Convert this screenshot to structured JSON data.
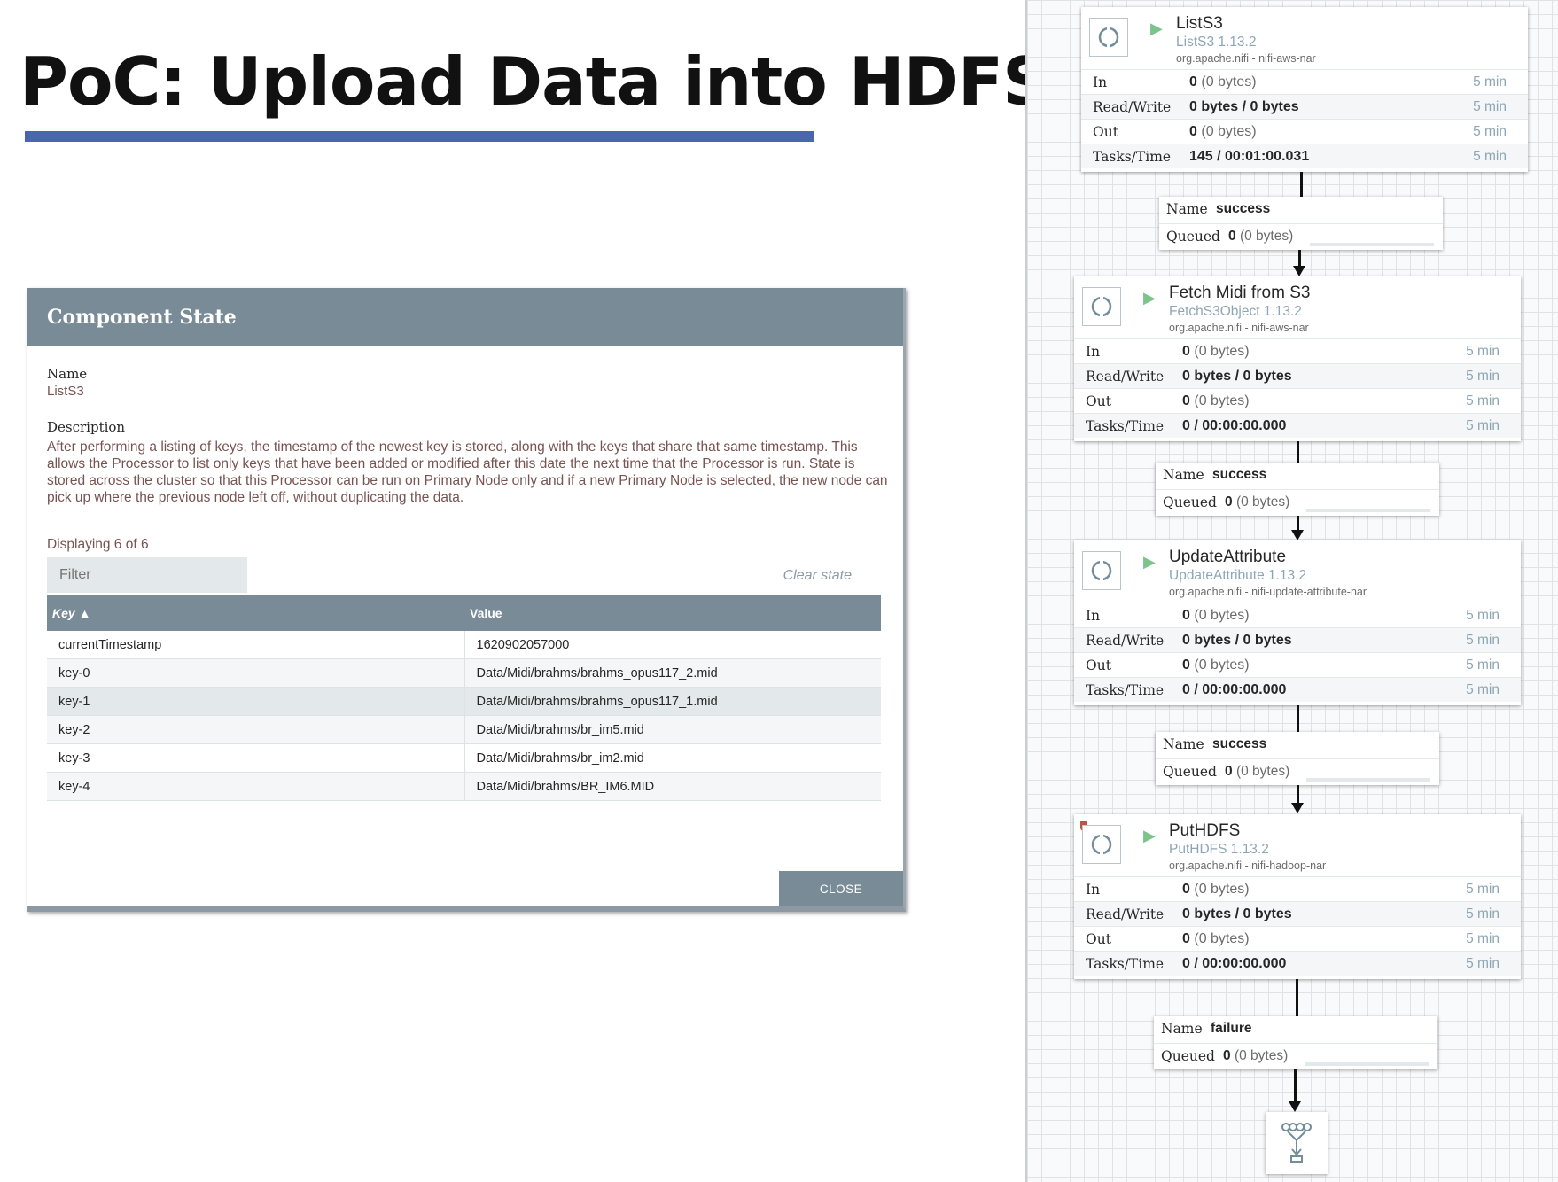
{
  "slide": {
    "title": "PoC: Upload Data into HDFS"
  },
  "dialog": {
    "title": "Component State",
    "name_label": "Name",
    "name_value": "ListS3",
    "description_label": "Description",
    "description": "After performing a listing of keys, the timestamp of the newest key is stored, along with the keys that share that same timestamp. This allows the Processor to list only keys that have been added or modified after this date the next time that the Processor is run. State is stored across the cluster so that this Processor can be run on Primary Node only and if a new Primary Node is selected, the new node can pick up where the previous node left off, without duplicating the data.",
    "displaying": "Displaying 6 of 6",
    "filter_placeholder": "Filter",
    "clear_state": "Clear state",
    "columns": {
      "key": "Key ▲",
      "value": "Value"
    },
    "rows": [
      {
        "key": "currentTimestamp",
        "value": "1620902057000"
      },
      {
        "key": "key-0",
        "value": "Data/Midi/brahms/brahms_opus117_2.mid"
      },
      {
        "key": "key-1",
        "value": "Data/Midi/brahms/brahms_opus117_1.mid"
      },
      {
        "key": "key-2",
        "value": "Data/Midi/brahms/br_im5.mid"
      },
      {
        "key": "key-3",
        "value": "Data/Midi/brahms/br_im2.mid"
      },
      {
        "key": "key-4",
        "value": "Data/Midi/brahms/BR_IM6.MID"
      }
    ],
    "close_label": "CLOSE"
  },
  "stat_labels": {
    "in": "In",
    "rw": "Read/Write",
    "out": "Out",
    "tasks": "Tasks/Time",
    "time": "5 min"
  },
  "conn_labels": {
    "name": "Name",
    "queued": "Queued",
    "count": "0",
    "bytes": "(0 bytes)"
  },
  "processors": [
    {
      "name": "ListS3",
      "type": "ListS3 1.13.2",
      "bundle": "org.apache.nifi - nifi-aws-nar",
      "in_count": "0",
      "in_bytes": "(0 bytes)",
      "rw": "0 bytes / 0 bytes",
      "out_count": "0",
      "out_bytes": "(0 bytes)",
      "tasks": "145 / 00:01:00.031"
    },
    {
      "name": "Fetch Midi from S3",
      "type": "FetchS3Object 1.13.2",
      "bundle": "org.apache.nifi - nifi-aws-nar",
      "in_count": "0",
      "in_bytes": "(0 bytes)",
      "rw": "0 bytes / 0 bytes",
      "out_count": "0",
      "out_bytes": "(0 bytes)",
      "tasks": "0 / 00:00:00.000"
    },
    {
      "name": "UpdateAttribute",
      "type": "UpdateAttribute 1.13.2",
      "bundle": "org.apache.nifi - nifi-update-attribute-nar",
      "in_count": "0",
      "in_bytes": "(0 bytes)",
      "rw": "0 bytes / 0 bytes",
      "out_count": "0",
      "out_bytes": "(0 bytes)",
      "tasks": "0 / 00:00:00.000"
    },
    {
      "name": "PutHDFS",
      "type": "PutHDFS 1.13.2",
      "bundle": "org.apache.nifi - nifi-hadoop-nar",
      "in_count": "0",
      "in_bytes": "(0 bytes)",
      "rw": "0 bytes / 0 bytes",
      "out_count": "0",
      "out_bytes": "(0 bytes)",
      "tasks": "0 / 00:00:00.000"
    }
  ],
  "connections": [
    {
      "name": "success"
    },
    {
      "name": "success"
    },
    {
      "name": "success"
    },
    {
      "name": "failure"
    }
  ],
  "colors": {
    "header": "#7a8b98",
    "title_bar": "#4a67ae",
    "run": "#7dc48c",
    "bulletin": "#ba554a",
    "description_text": "#775351"
  }
}
